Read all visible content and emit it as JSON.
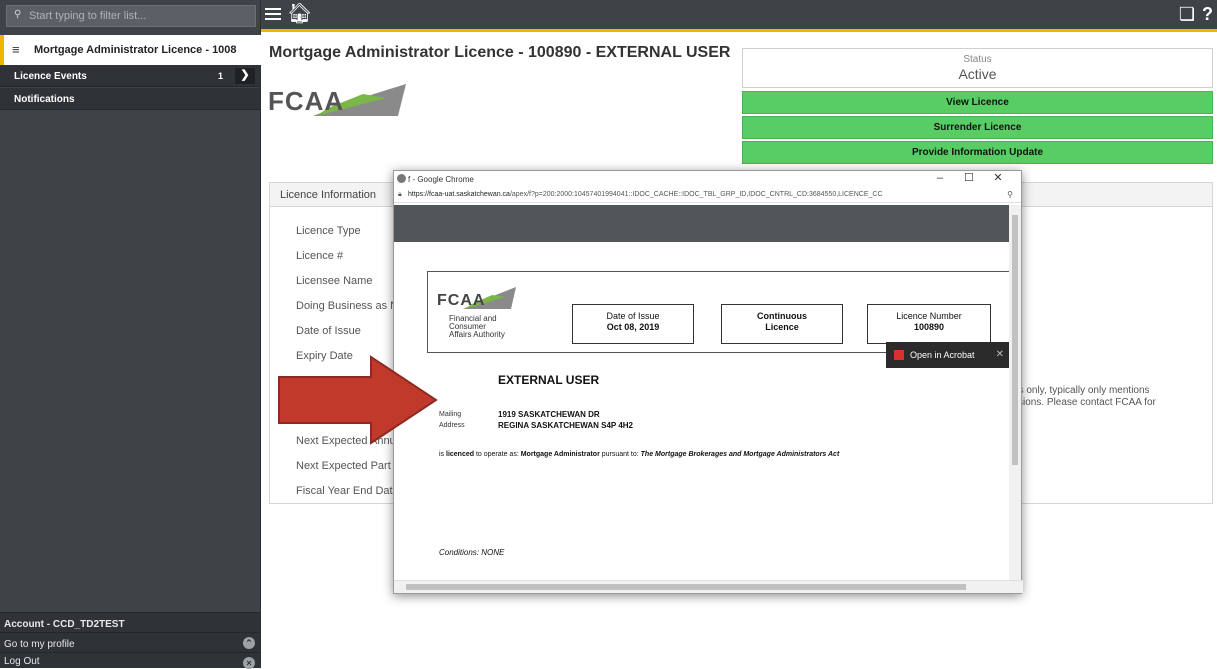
{
  "sidebar": {
    "filter_placeholder": "Start typing to filter list...",
    "current_item": "Mortgage Administrator Licence - 1008",
    "licence_events": {
      "label": "Licence Events",
      "count": "1"
    },
    "notifications": "Notifications",
    "account": "Account - CCD_TD2TEST",
    "go_to_profile": "Go to my profile",
    "log_out": "Log Out"
  },
  "topbar": {
    "help": "?"
  },
  "page": {
    "title": "Mortgage Administrator Licence - 100890 - EXTERNAL USER",
    "logo": "FCAA",
    "status_label": "Status",
    "status_value": "Active",
    "buttons": {
      "view_licence": "View Licence",
      "surrender_licence": "Surrender Licence",
      "provide_update": "Provide Information Update"
    },
    "info_panel": {
      "header": "Licence Information",
      "fields": [
        "Licence Type",
        "Licence #",
        "Licensee Name",
        "Doing Business as Na",
        "Date of Issue",
        "Expiry Date",
        "Next Expected Annua",
        "Next Expected Part V",
        "Fiscal Year End Date"
      ],
      "note_line1": "es only, typically only mentions",
      "note_line2": "ssions. Please contact FCAA for"
    }
  },
  "popup": {
    "window_title": "f - Google Chrome",
    "url_host": "https://fcaa-uat.saskatchewan.ca",
    "url_path": "/apex/f?p=200:2000:10457401994041::IDOC_CACHE::IDOC_TBL_GRP_ID,IDOC_CNTRL_CD:3684550,LICENCE_CC",
    "controls": {
      "minimize": "–",
      "maximize": "☐",
      "close": "✕"
    },
    "open_in_acrobat": "Open in Acrobat",
    "certificate": {
      "logo": "FCAA",
      "org_line1": "Financial and",
      "org_line2": "Consumer",
      "org_line3": "Affairs Authority",
      "date_of_issue_label": "Date of Issue",
      "date_of_issue_value": "Oct 08, 2019",
      "continuous_line1": "Continuous",
      "continuous_line2": "Licence",
      "licence_number_label": "Licence Number",
      "licence_number_value": "100890",
      "holder": "EXTERNAL USER",
      "mailing_label": "Mailing",
      "address_label": "Address",
      "address_line1": "1919 SASKATCHEWAN DR",
      "address_line2": "REGINA SASKATCHEWAN S4P 4H2",
      "licensed_prefix": "is ",
      "licensed_word": "licenced",
      "licensed_mid": " to operate as: ",
      "licensed_type": "Mortgage Administrator",
      "licensed_pursuant": " pursuant to: ",
      "licensed_act": "The Mortgage Brokerages and Mortgage Administrators Act",
      "conditions": "Conditions: NONE"
    }
  },
  "colors": {
    "sidebar_bg": "#3e4348",
    "accent": "#f1b400",
    "green_button": "#58cd64",
    "arrow": "#c0392b"
  }
}
